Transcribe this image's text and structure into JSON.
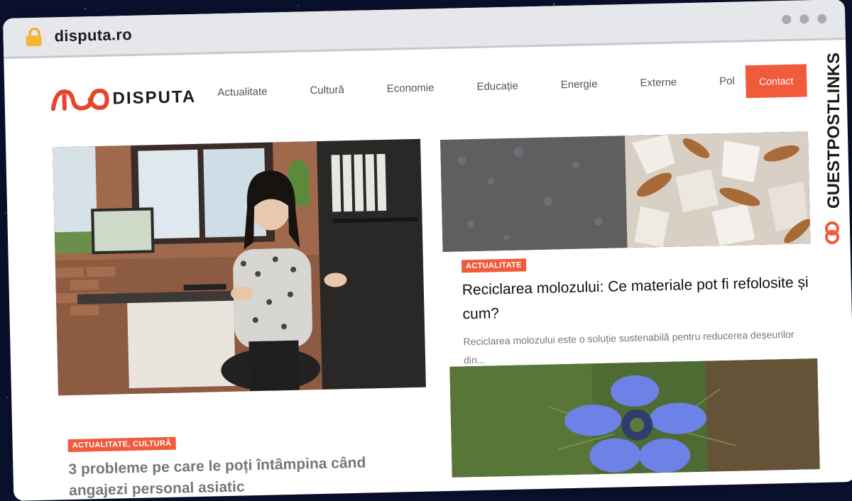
{
  "browser": {
    "url": "disputa.ro"
  },
  "site": {
    "logo_text": "DISPUTA",
    "nav": [
      "Actualitate",
      "Cultură",
      "Economie",
      "Educație",
      "Energie",
      "Externe",
      "Pol"
    ],
    "contact_label": "Contact"
  },
  "articles": {
    "featured": {
      "tag": "ACTUALITATE",
      "title": "Reciclarea molozului: Ce materiale pot fi refolosite și cum?",
      "excerpt": "Reciclarea molozului este o soluție sustenabilă pentru reducerea deșeurilor din..."
    },
    "main": {
      "tag": "ACTUALITATE, CULTURĂ",
      "title": "3 probleme pe care le poți întâmpina când angajezi personal asiatic"
    }
  },
  "watermark": {
    "text": "GUESTPOSTLINKS"
  },
  "colors": {
    "accent": "#f15a3a",
    "logo_red": "#e8442b"
  }
}
